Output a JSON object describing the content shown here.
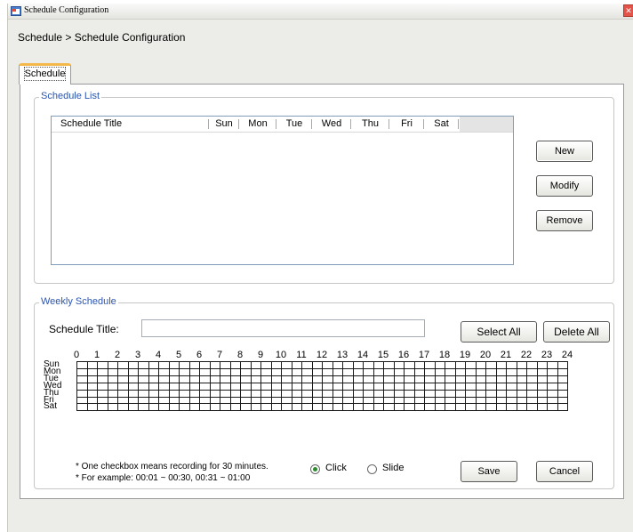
{
  "window": {
    "title": "Schedule Configuration",
    "close_glyph": "✕"
  },
  "breadcrumb": "Schedule > Schedule Configuration",
  "tab": {
    "label": "Schedule"
  },
  "schedule_list": {
    "legend": "Schedule List",
    "columns": [
      "Schedule Title",
      "Sun",
      "Mon",
      "Tue",
      "Wed",
      "Thu",
      "Fri",
      "Sat"
    ],
    "rows": [],
    "buttons": {
      "new": "New",
      "modify": "Modify",
      "remove": "Remove"
    }
  },
  "weekly": {
    "legend": "Weekly Schedule",
    "title_label": "Schedule Title:",
    "title_value": "",
    "select_all": "Select All",
    "delete_all": "Delete All",
    "hours": [
      "0",
      "1",
      "2",
      "3",
      "4",
      "5",
      "6",
      "7",
      "8",
      "9",
      "10",
      "11",
      "12",
      "13",
      "14",
      "15",
      "16",
      "17",
      "18",
      "19",
      "20",
      "21",
      "22",
      "23",
      "24"
    ],
    "days": [
      "Sun",
      "Mon",
      "Tue",
      "Wed",
      "Thu",
      "Fri",
      "Sat"
    ],
    "slots_per_day": 48,
    "note_line1": "* One checkbox means recording for 30 minutes.",
    "note_line2": "* For example: 00:01 ~ 00:30, 00:31 ~ 01:00",
    "mode_options": [
      "Click",
      "Slide"
    ],
    "mode_selected": "Click",
    "save": "Save",
    "cancel": "Cancel"
  },
  "colors": {
    "legend": "#2a55b0",
    "tab_accent": "#f3b74a",
    "radio_dot": "#2d8a2d",
    "close": "#e2534a"
  },
  "icons": {
    "app": "window-app-icon",
    "close": "close-icon"
  }
}
